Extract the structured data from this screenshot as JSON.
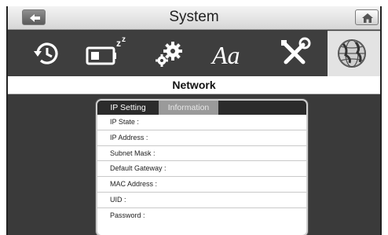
{
  "titlebar": {
    "title": "System",
    "back_icon": "back-arrow-icon",
    "home_icon": "home-icon"
  },
  "toolbar": {
    "items": [
      {
        "icon": "history-clock-icon"
      },
      {
        "icon": "battery-sleep-icon"
      },
      {
        "icon": "gears-icon"
      },
      {
        "icon": "font-icon",
        "glyph": "Aa"
      },
      {
        "icon": "tools-icon"
      },
      {
        "icon": "globe-network-icon",
        "active": true
      }
    ]
  },
  "section": {
    "title": "Network"
  },
  "panel": {
    "tabs": [
      {
        "label": "IP Setting",
        "active": true
      },
      {
        "label": "Information",
        "active": false
      }
    ],
    "rows": [
      {
        "label": "IP State :"
      },
      {
        "label": "IP Address :"
      },
      {
        "label": "Subnet Mask :"
      },
      {
        "label": "Default Gateway :"
      },
      {
        "label": "MAC Address :"
      },
      {
        "label": "UID :"
      },
      {
        "label": "Password :"
      }
    ]
  },
  "colors": {
    "toolbar_bg": "#3e3e3e",
    "active_tool_bg": "#e3e3e3",
    "tab_active_bg": "#2b2b2b",
    "tab_inactive_bg": "#9a9a9a"
  }
}
